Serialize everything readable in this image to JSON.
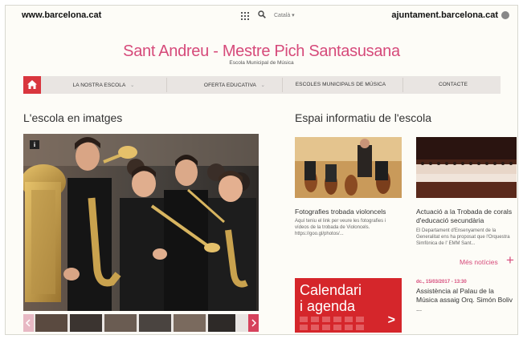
{
  "topbar": {
    "site_left": "www.barcelona.cat",
    "language": "Català ▾",
    "site_right": "ajuntament.barcelona.cat",
    "icons": [
      "apps-grid-icon",
      "search-icon",
      "circle-icon"
    ]
  },
  "header": {
    "title": "Sant Andreu - Mestre Pich Santasusana",
    "subtitle": "Escola Municipal de Música"
  },
  "nav": {
    "home_icon": "home-icon",
    "items": [
      {
        "label": "LA NOSTRA ESCOLA",
        "chevron": "⌄"
      },
      {
        "label": "OFERTA EDUCATIVA",
        "chevron": "⌄"
      },
      {
        "label": "ESCOLES MUNICIPALS DE MÚSICA"
      },
      {
        "label": "CONTACTE"
      }
    ]
  },
  "gallery": {
    "heading": "L'escola en imatges",
    "info_badge": "i",
    "thumb_count": 7
  },
  "info": {
    "heading": "Espai informatiu de l'escola",
    "news": [
      {
        "title": "Fotografies trobada violoncels",
        "text": "Aquí teniu el link per veure les fotografies i vídeos de la trobada de Violoncels. https://goo.gl/photos/..."
      },
      {
        "title": "Actuació a la Trobada de corals d'educació secundària",
        "text": "El Departament d'Ensenyament de la Generalitat ens ha proposat que l'Orquestra Simfònica de l' EMM Sant..."
      }
    ],
    "more_label": "Més notícies",
    "more_icon": "+"
  },
  "agenda": {
    "line1": "Calendari",
    "line2": "i agenda",
    "arrow": ">",
    "event_date": "dc., 15/03/2017 - 13:30",
    "event_title": "Assistència al Palau de la Música assaig Orq. Simón Boliv ..."
  },
  "colors": {
    "accent": "#d64a7a",
    "red": "#d5262b",
    "nav_bg": "#e9e5e2"
  }
}
